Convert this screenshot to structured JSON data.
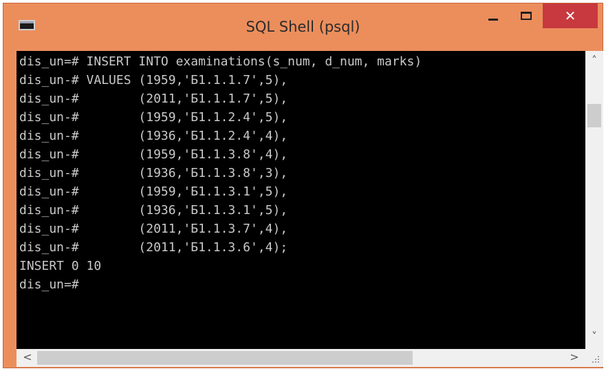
{
  "window": {
    "title": "SQL Shell (psql)",
    "close_glyph": "✕"
  },
  "console": {
    "lines": [
      "dis_un=# INSERT INTO examinations(s_num, d_num, marks)",
      "dis_un-# VALUES (1959,'Б1.1.1.7',5),",
      "dis_un-#        (2011,'Б1.1.1.7',5),",
      "dis_un-#        (1959,'Б1.1.2.4',5),",
      "dis_un-#        (1936,'Б1.1.2.4',4),",
      "dis_un-#        (1959,'Б1.1.3.8',4),",
      "dis_un-#        (1936,'Б1.1.3.8',3),",
      "dis_un-#        (1959,'Б1.1.3.1',5),",
      "dis_un-#        (1936,'Б1.1.3.1',5),",
      "dis_un-#        (2011,'Б1.1.3.7',4),",
      "dis_un-#        (2011,'Б1.1.3.6',4);",
      "INSERT 0 10",
      "dis_un=#"
    ]
  },
  "scrollbars": {
    "up": "˄",
    "down": "˅",
    "left": "<",
    "right": ">"
  },
  "colors": {
    "title_bar": "#ec8e5c",
    "close_button": "#c7393e",
    "console_background": "#000000",
    "console_text": "#c9c9c9"
  }
}
